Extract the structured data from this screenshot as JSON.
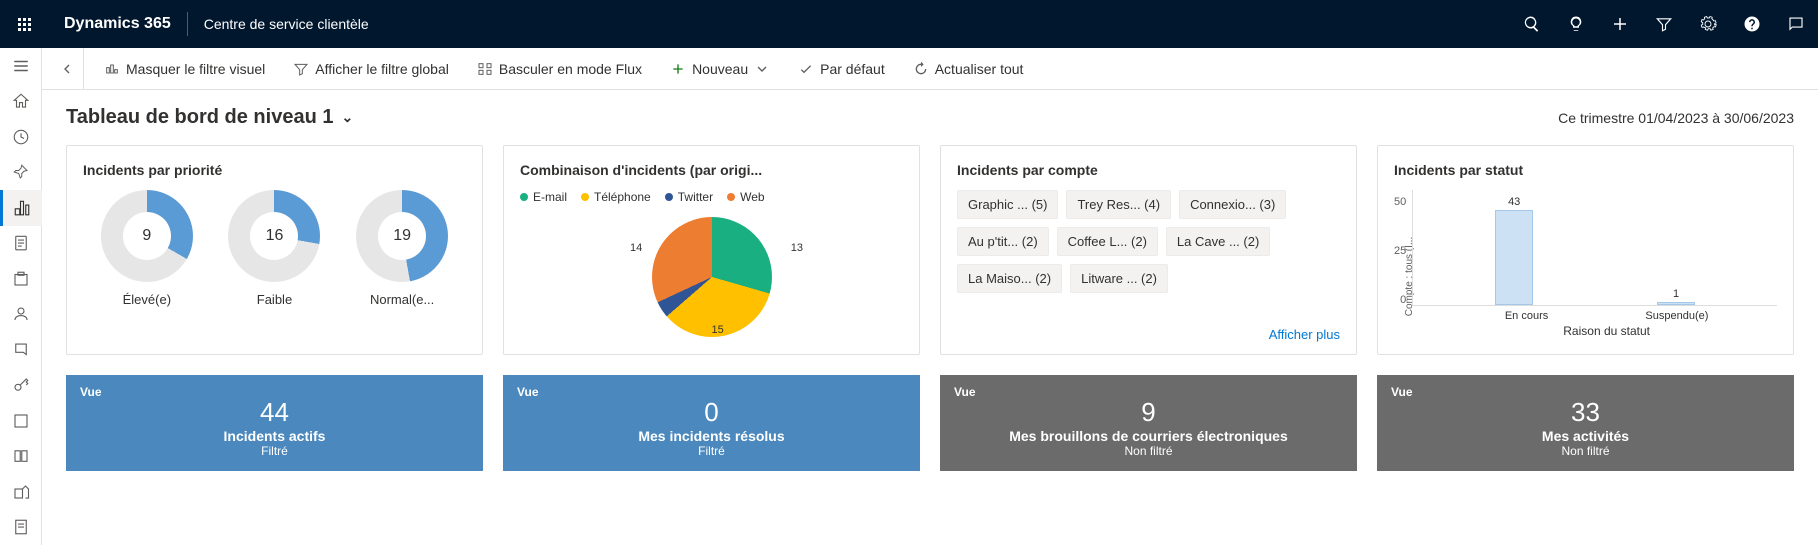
{
  "topbar": {
    "brand": "Dynamics 365",
    "app_name": "Centre de service clientèle"
  },
  "commands": {
    "hide_visual_filter": "Masquer le filtre visuel",
    "show_global_filter": "Afficher le filtre global",
    "switch_flow": "Basculer en mode Flux",
    "new": "Nouveau",
    "default": "Par défaut",
    "refresh_all": "Actualiser tout"
  },
  "page": {
    "title": "Tableau de bord de niveau 1",
    "time_range": "Ce trimestre 01/04/2023 à 30/06/2023"
  },
  "card_priority": {
    "title": "Incidents par priorité"
  },
  "chart_data": [
    {
      "type": "donut",
      "title": "Incidents par priorité",
      "series": [
        {
          "name": "Élevé(e)",
          "value": 9,
          "highlight_deg": 120
        },
        {
          "name": "Faible",
          "value": 16,
          "highlight_deg": 100
        },
        {
          "name": "Normal(e...",
          "value": 19,
          "highlight_deg": 170
        }
      ],
      "colors": {
        "highlight": "#5b9bd5",
        "base": "#e6e6e6"
      }
    },
    {
      "type": "pie",
      "title": "Combinaison d'incidents (par origi...",
      "series": [
        {
          "name": "E-mail",
          "value": 13,
          "color": "#1aaf81"
        },
        {
          "name": "Téléphone",
          "value": 15,
          "color": "#ffc000"
        },
        {
          "name": "Twitter",
          "value": 2,
          "color": "#2f5597"
        },
        {
          "name": "Web",
          "value": 14,
          "color": "#ed7d31"
        }
      ]
    },
    {
      "type": "bar",
      "title": "Incidents par statut",
      "categories": [
        "En cours",
        "Suspendu(e)"
      ],
      "values": [
        43,
        1
      ],
      "ylabel": "Compte : tous (I...",
      "xlabel": "Raison du statut",
      "ylim": [
        0,
        50
      ],
      "ticks": [
        50,
        25,
        0
      ]
    }
  ],
  "card_combo": {
    "title": "Combinaison d'incidents (par origi...",
    "legend": [
      {
        "name": "E-mail",
        "color": "#1aaf81"
      },
      {
        "name": "Téléphone",
        "color": "#ffc000"
      },
      {
        "name": "Twitter",
        "color": "#2f5597"
      },
      {
        "name": "Web",
        "color": "#ed7d31"
      }
    ],
    "slice_labels": {
      "email": "13",
      "web": "14",
      "phone": "15"
    }
  },
  "card_account": {
    "title": "Incidents par compte",
    "tags": [
      "Graphic ... (5)",
      "Trey Res... (4)",
      "Connexio... (3)",
      "Au p'tit... (2)",
      "Coffee L... (2)",
      "La Cave ... (2)",
      "La Maiso... (2)",
      "Litware ... (2)"
    ],
    "show_more": "Afficher plus"
  },
  "card_status": {
    "title": "Incidents par statut"
  },
  "tiles": [
    {
      "view": "Vue",
      "value": "44",
      "label": "Incidents actifs",
      "sub": "Filtré",
      "color": "blue"
    },
    {
      "view": "Vue",
      "value": "0",
      "label": "Mes incidents résolus",
      "sub": "Filtré",
      "color": "blue"
    },
    {
      "view": "Vue",
      "value": "9",
      "label": "Mes brouillons de courriers électroniques",
      "sub": "Non filtré",
      "color": "gray"
    },
    {
      "view": "Vue",
      "value": "33",
      "label": "Mes activités",
      "sub": "Non filtré",
      "color": "gray"
    }
  ]
}
